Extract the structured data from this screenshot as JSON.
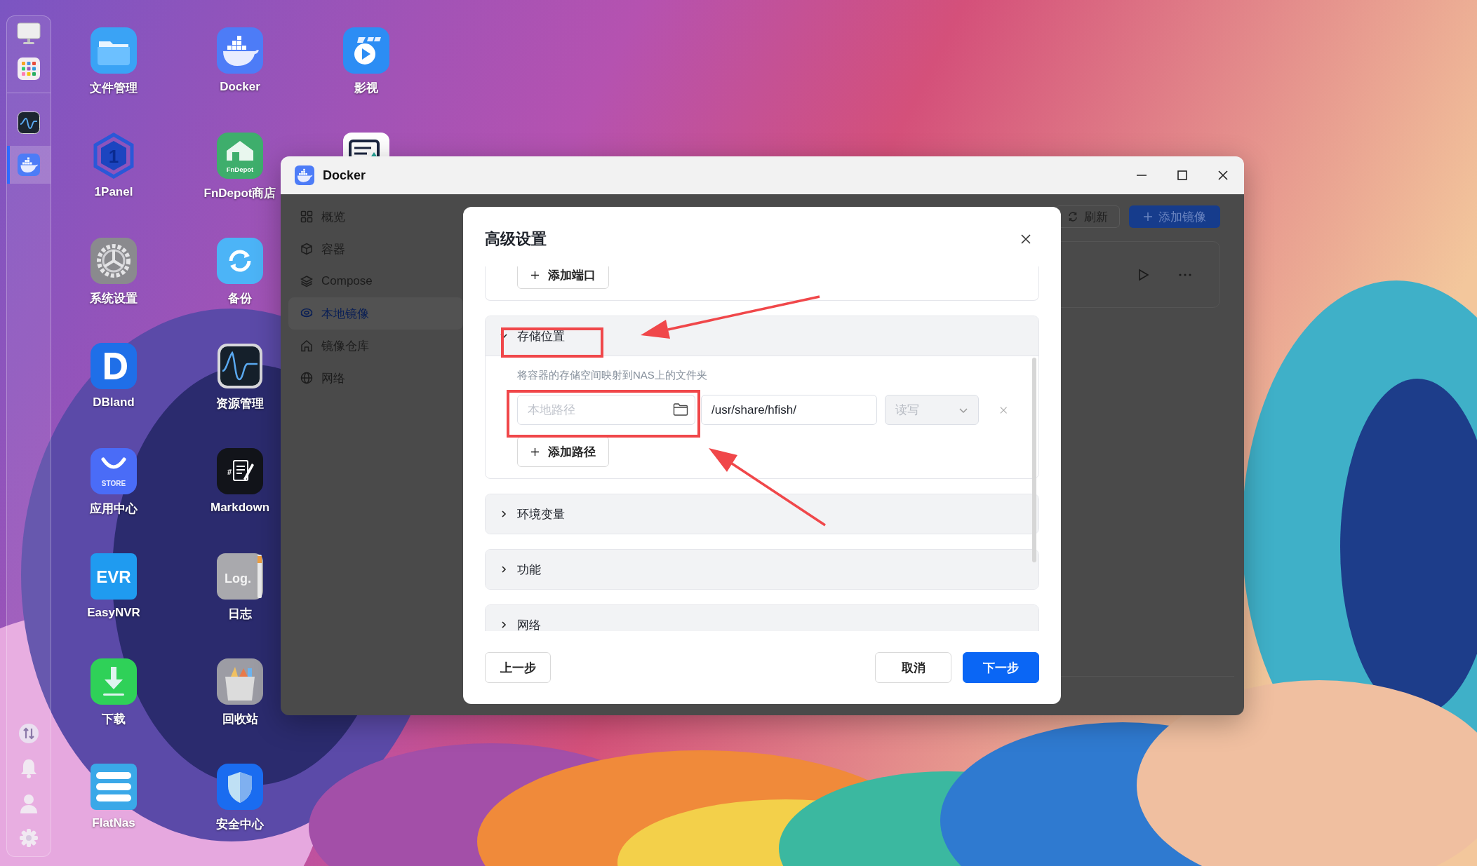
{
  "dock": {
    "items": [
      {
        "selected": false
      },
      {
        "selected": false
      },
      {
        "selected": false
      },
      {
        "selected": true
      }
    ]
  },
  "desktop_icons": [
    {
      "label": "文件管理"
    },
    {
      "label": "1Panel",
      "logo_text": "1"
    },
    {
      "label": "系统设置"
    },
    {
      "label": "DBland"
    },
    {
      "label": "应用中心",
      "logo_text": "STORE"
    },
    {
      "label": "EasyNVR",
      "logo_text": "EVR"
    },
    {
      "label": "下载"
    },
    {
      "label": "FlatNas"
    },
    {
      "label": "Docker"
    },
    {
      "label": "FnDepot商店",
      "logo_text": "FnDepot"
    },
    {
      "label": "备份"
    },
    {
      "label": "资源管理"
    },
    {
      "label": "Markdown",
      "logo_text": "#"
    },
    {
      "label": "日志",
      "logo_text": "Log."
    },
    {
      "label": "回收站"
    },
    {
      "label": "安全中心"
    },
    {
      "label": "影视"
    }
  ],
  "window": {
    "title": "Docker",
    "sidebar": {
      "items": [
        {
          "label": "概览",
          "selected": false
        },
        {
          "label": "容器",
          "selected": false
        },
        {
          "label": "Compose",
          "selected": false
        },
        {
          "label": "本地镜像",
          "selected": true
        },
        {
          "label": "镜像仓库",
          "selected": false
        },
        {
          "label": "网络",
          "selected": false
        }
      ]
    },
    "toolbar": {
      "buttons": [
        {
          "label": "刷新",
          "kind": "refresh"
        },
        {
          "label": "添加镜像",
          "kind": "primary"
        }
      ]
    }
  },
  "dialog": {
    "title": "高级设置",
    "ports": {
      "add_button": "添加端口"
    },
    "sections": [
      {
        "title": "存储位置",
        "expanded": true,
        "description": "将容器的存储空间映射到NAS上的文件夹",
        "mappings": [
          {
            "local_path": {
              "placeholder": "本地路径"
            },
            "container_path": {
              "value": "/usr/share/hfish/"
            },
            "mode": {
              "value": "读写",
              "disabled": true
            }
          }
        ],
        "add_button": "添加路径"
      },
      {
        "title": "环境变量",
        "expanded": false
      },
      {
        "title": "功能",
        "expanded": false
      },
      {
        "title": "网络",
        "expanded": false
      }
    ],
    "footer": {
      "back": "上一步",
      "cancel": "取消",
      "next": "下一步"
    }
  }
}
